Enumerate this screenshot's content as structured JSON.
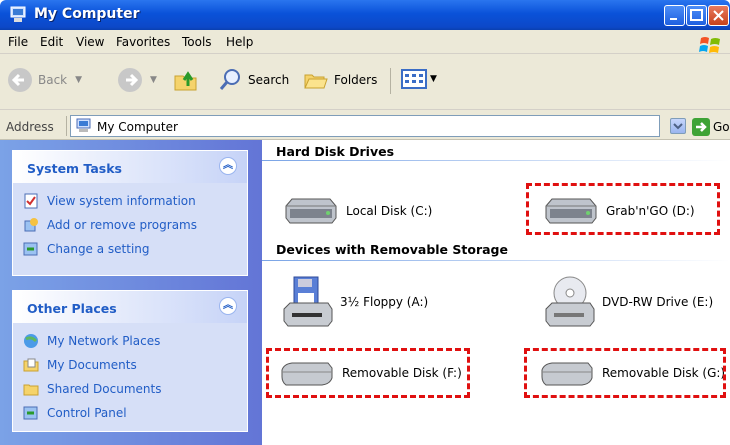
{
  "window": {
    "title": "My Computer"
  },
  "menu": [
    "File",
    "Edit",
    "View",
    "Favorites",
    "Tools",
    "Help"
  ],
  "toolbar": {
    "back": "Back",
    "search": "Search",
    "folders": "Folders"
  },
  "address": {
    "label": "Address",
    "value": "My Computer",
    "go": "Go"
  },
  "system_tasks": {
    "title": "System Tasks",
    "items": [
      "View system information",
      "Add or remove programs",
      "Change a setting"
    ]
  },
  "other_places": {
    "title": "Other Places",
    "items": [
      "My Network Places",
      "My Documents",
      "Shared Documents",
      "Control Panel"
    ]
  },
  "groups": {
    "hard_disks": {
      "title": "Hard Disk Drives",
      "drives": [
        "Local Disk (C:)",
        "Grab'n'GO (D:)"
      ]
    },
    "removable": {
      "title": "Devices with Removable Storage",
      "drives": [
        "3½ Floppy (A:)",
        "DVD-RW Drive (E:)",
        "Removable Disk (F:)",
        "Removable Disk (G:)"
      ]
    }
  },
  "highlight_color": "#e01010"
}
